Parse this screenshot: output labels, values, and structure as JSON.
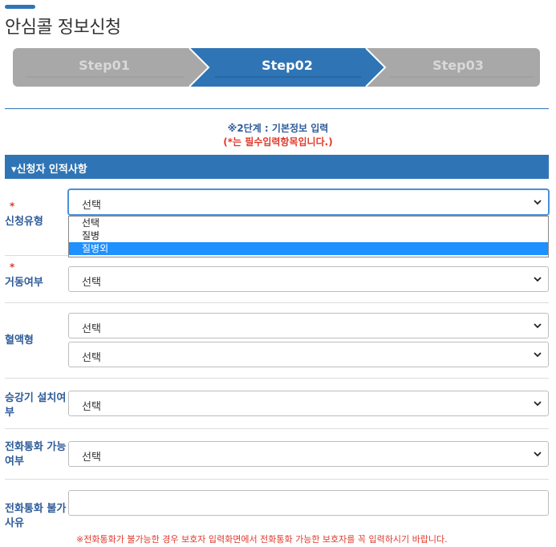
{
  "page": {
    "title": "안심콜 정보신청"
  },
  "steps": [
    {
      "label": "Step01",
      "active": false
    },
    {
      "label": "Step02",
      "active": true
    },
    {
      "label": "Step03",
      "active": false
    }
  ],
  "notice": {
    "line1": "※2단계 : 기본정보 입력",
    "line2": "(*는 필수입력항목입니다.)"
  },
  "section": {
    "title": "▾신청자 인적사항"
  },
  "form": {
    "required_mark": "*",
    "type": {
      "label": "신청유형",
      "value": "선택"
    },
    "type_options": [
      "선택",
      "질병",
      "질병외"
    ],
    "type_highlighted": "질병외",
    "living": {
      "label": "거동여부",
      "value": "선택"
    },
    "blood": {
      "label": "혈액형",
      "value1": "선택",
      "value2": "선택"
    },
    "elevator": {
      "label_line1": "승강기 설치여",
      "label_line2": "부",
      "value": "선택"
    },
    "phone_ok": {
      "label_line1": "전화통화 가능",
      "label_line2": "여부",
      "value": "선택"
    },
    "phone_reason": {
      "label_line1": "전화통화 불가",
      "label_line2": "사유",
      "value": ""
    }
  },
  "footnote": "※전화통화가 불가능한 경우 보호자 입력화면에서 전화통화 가능한 보호자를 꼭 입력하시기 바랍니다.",
  "colors": {
    "primary": "#2f75b5",
    "required": "#e0392b",
    "step_inactive": "#a8a8a8"
  }
}
